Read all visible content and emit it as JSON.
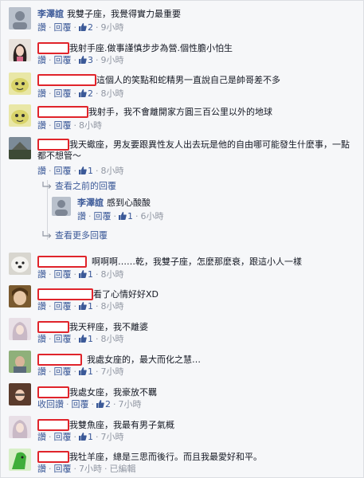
{
  "comments": [
    {
      "name": "李澤誼",
      "text": "我雙子座，我覺得實力最重要",
      "reply": "回覆",
      "likes": "2",
      "time": "9小時"
    },
    {
      "text": "我射手座.做事謹慎步步為營.個性膽小怕生",
      "reply": "回覆",
      "likes": "3",
      "time": "9小時"
    },
    {
      "text": "這個人的笑點和蛇精男一直說自己是帥哥差不多",
      "reply": "回覆",
      "likes": "2",
      "time": "8小時"
    },
    {
      "text": "我射手，我不會離開家方圓三百公里以外的地球",
      "reply": "回覆",
      "time": "8小時"
    },
    {
      "text": "我天蠍座，男友要跟異性友人出去玩是他的自由哪可能發生什麼事，一點都不想管～",
      "reply": "回覆",
      "likes": "1",
      "time": "8小時"
    },
    {
      "text": "啊啊啊……乾，我雙子座，怎麼那麼衰，跟這小人一樣",
      "reply": "回覆",
      "likes": "1",
      "time": "8小時"
    },
    {
      "text": "看了心情好好XD",
      "reply": "回覆",
      "likes": "1",
      "time": "8小時"
    },
    {
      "text": "我天秤座，我不離婆",
      "reply": "回覆",
      "likes": "1",
      "time": "8小時"
    },
    {
      "text": "我處女座的，最大而化之慧…",
      "reply": "回覆",
      "likes": "1",
      "time": "7小時"
    },
    {
      "text": "我處女座，我豪放不羈",
      "recall": "收回讚",
      "reply": "回覆",
      "likes": "2",
      "time": "7小時"
    },
    {
      "text": "我雙魚座，我最有男子氣概",
      "reply": "回覆",
      "likes": "1",
      "time": "7小時"
    },
    {
      "text": "我牡羊座，總是三思而後行。而且我最愛好和平。",
      "reply": "回覆",
      "time": "7小時",
      "edited": "已編輯"
    }
  ],
  "replies": {
    "view_previous": "查看之前的回覆",
    "item": {
      "name": "李澤誼",
      "text": "感到心酸酸",
      "reply": "回覆",
      "likes": "1",
      "time": "6小時"
    },
    "view_more": "查看更多回覆"
  },
  "labels": {
    "like": "讚",
    "sep": "·"
  },
  "colors": {
    "link": "#3b5998",
    "meta": "#9197a3",
    "redaction": "#e0242b",
    "background": "#f6f7f9"
  }
}
